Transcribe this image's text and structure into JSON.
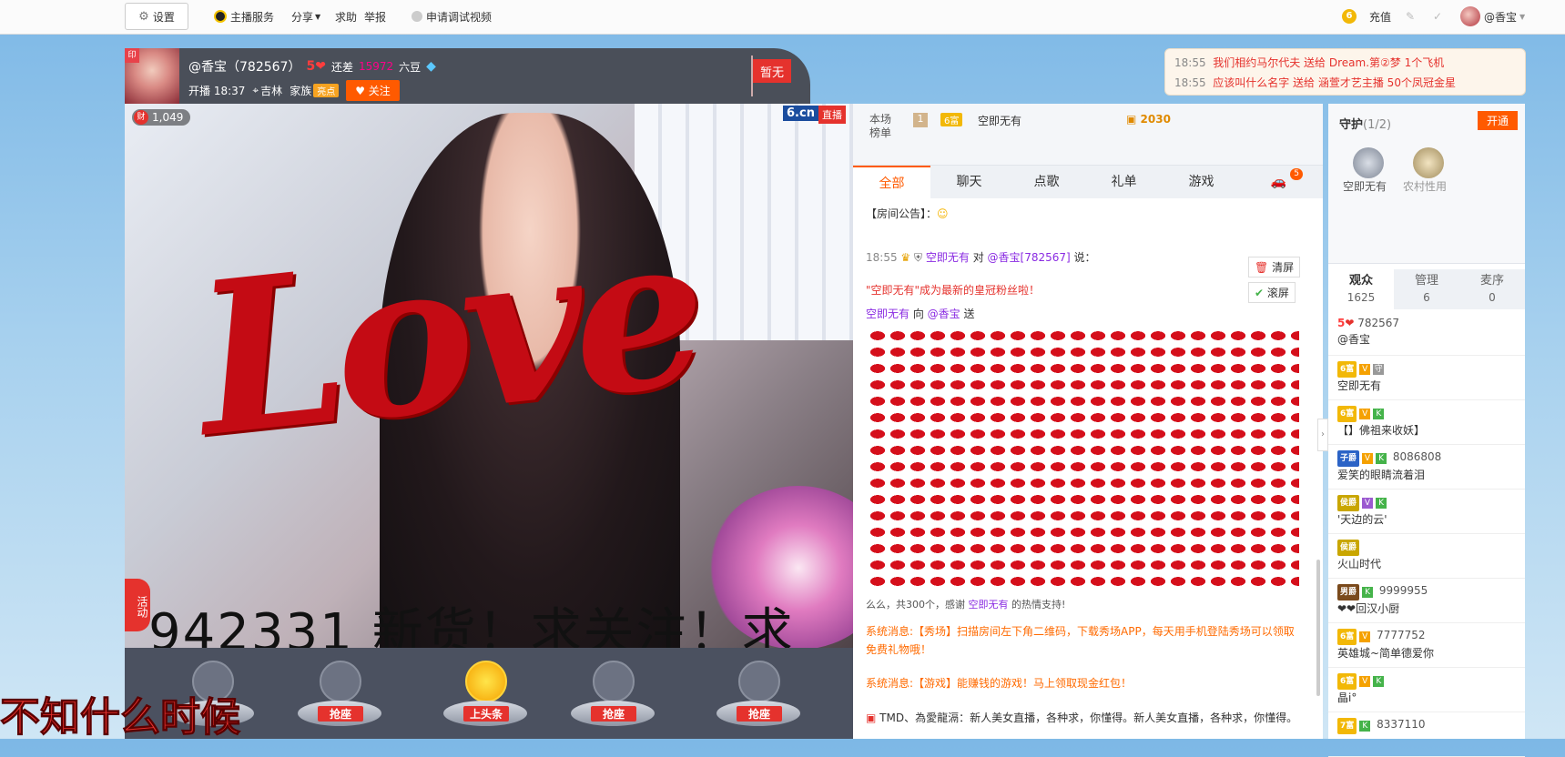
{
  "topbar": {
    "settings": "设置",
    "host_service": "主播服务",
    "share": "分享",
    "help": "求助",
    "report": "举报",
    "apply_video": "申请调试视频",
    "recharge": "充值",
    "coin_label": "6",
    "user": "@香宝"
  },
  "host": {
    "name": "@香宝（782567）",
    "level": "5",
    "diff_prefix": "还差",
    "diff_value": "15972",
    "diff_suffix": "六豆",
    "start_time": "开播 18:37",
    "location": "吉林",
    "family_label": "家族",
    "family_tag": "亮点",
    "follow": "关注",
    "flag": "暂无",
    "avatar_tag": "印"
  },
  "video": {
    "wealth_icon": "财",
    "wealth_count": "1,049",
    "brand": "6.cn",
    "live": "直播",
    "love_text": "Love",
    "ticker": "942331  新货！求关注！求",
    "activity": "活动",
    "bottom_overlay": "不知什么时候"
  },
  "seats": [
    {
      "label": "抢座"
    },
    {
      "label": "抢座"
    },
    {
      "label": "上头条"
    },
    {
      "label": "抢座"
    },
    {
      "label": "抢座"
    }
  ],
  "gift_feed": [
    {
      "time": "18:55",
      "text": "我们相约马尔代夫 送给 Dream.第②梦 1个飞机"
    },
    {
      "time": "18:55",
      "text": "应该叫什么名字 送给 涵萱才艺主播 50个凤冠金星"
    }
  ],
  "rank": {
    "label": "本场榜单",
    "rank_no": "1",
    "top_user_badge": "6富",
    "top_user": "空即无有",
    "coins": "2030"
  },
  "chat": {
    "tabs": [
      "全部",
      "聊天",
      "点歌",
      "礼单",
      "游戏"
    ],
    "game_badge": "5",
    "notice": "【房间公告】：",
    "clear": "清屏",
    "scroll": "滚屏",
    "msg1_time": "18:55",
    "msg1_user": "空即无有",
    "msg1_mid": " 对 ",
    "msg1_target": "@香宝[782567]",
    "msg1_tail": " 说：",
    "msg2": "\"空即无有\"成为最新的皇冠粉丝啦！",
    "msg3_user": "空即无有",
    "msg3_mid": " 向 ",
    "msg3_target": "@香宝",
    "msg3_tail": " 送",
    "msg4_pre": "么么，共300个，感谢 ",
    "msg4_user": "空即无有",
    "msg4_post": " 的热情支持!",
    "sys1": "系统消息:【秀场】扫描房间左下角二维码，下载秀场APP，每天用手机登陆秀场可以领取免费礼物哦！",
    "sys2": "系统消息:【游戏】能赚钱的游戏！马上领取现金红包！",
    "bottom": "TMD、為愛龍滆：新人美女直播，各种求，你懂得。新人美女直播，各种求，你懂得。"
  },
  "guard": {
    "title": "守护",
    "count": "(1/2)",
    "open": "开通",
    "members": [
      "空即无有",
      "农村性用"
    ]
  },
  "audience": {
    "tabs": [
      {
        "label": "观众",
        "count": "1625"
      },
      {
        "label": "管理",
        "count": "6"
      },
      {
        "label": "麦序",
        "count": "0"
      }
    ],
    "list": [
      {
        "badge": "5",
        "id": "782567",
        "name": "@香宝"
      },
      {
        "badge": "6富",
        "id": "",
        "name": "空即无有"
      },
      {
        "badge": "6富",
        "id": "",
        "name": "【】佛祖来收妖】"
      },
      {
        "badge": "子爵",
        "id": "8086808",
        "name": "爱笑的眼睛流着泪"
      },
      {
        "badge": "侯爵",
        "id": "",
        "name": "'天边的云'"
      },
      {
        "badge": "侯爵",
        "id": "",
        "name": "火山时代"
      },
      {
        "badge": "男爵",
        "id": "9999955",
        "name": "❤❤回汉小厨"
      },
      {
        "badge": "6富",
        "id": "7777752",
        "name": "英雄城~简单德爱你"
      },
      {
        "badge": "6富",
        "id": "",
        "name": "晶i°"
      },
      {
        "badge": "7富",
        "id": "8337110",
        "name": ""
      }
    ]
  }
}
